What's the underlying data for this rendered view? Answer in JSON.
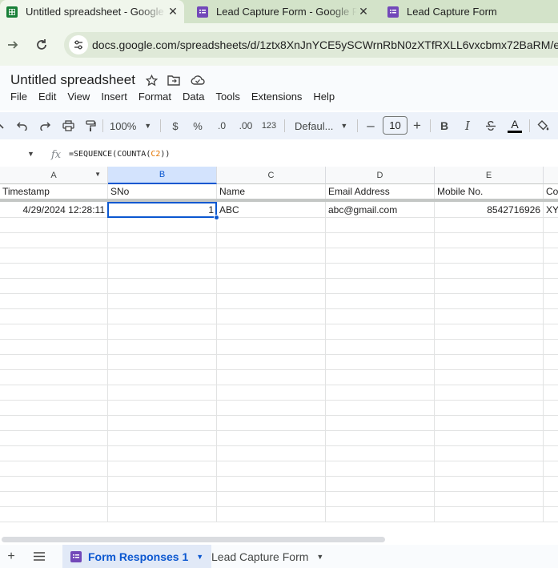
{
  "browser": {
    "tabs": [
      {
        "title": "Untitled spreadsheet - Google Sheets",
        "icon": "sheets-icon",
        "active": true
      },
      {
        "title": "Lead Capture Form - Google Forms",
        "icon": "forms-icon",
        "active": false
      },
      {
        "title": "Lead Capture Form",
        "icon": "forms-icon",
        "active": false
      }
    ],
    "url": "docs.google.com/spreadsheets/d/1ztx8XnJnYCE5ySCWrnRbN0zXTfRXLL6vxcbmx72BaRM/edit#"
  },
  "app": {
    "title": "Untitled spreadsheet",
    "menus": [
      "File",
      "Edit",
      "View",
      "Insert",
      "Format",
      "Data",
      "Tools",
      "Extensions",
      "Help"
    ]
  },
  "toolbar": {
    "zoom": "100%",
    "currency": "$",
    "percent": "%",
    "decimal_decrease": ".0",
    "decimal_increase": ".00",
    "number_format": "123",
    "font": "Defaul...",
    "font_size": "10",
    "bold": "B",
    "italic": "I",
    "text_color": "A"
  },
  "formula_bar": {
    "fx": "fx",
    "formula_prefix": "=SEQUENCE(COUNTA(",
    "formula_ref": "C2",
    "formula_suffix": "))"
  },
  "grid": {
    "columns": [
      "A",
      "B",
      "C",
      "D",
      "E"
    ],
    "selected_column": "B",
    "header_row": [
      "Timestamp",
      "SNo",
      "Name",
      "Email Address",
      "Mobile No.",
      "Co"
    ],
    "data_rows": [
      [
        "4/29/2024 12:28:11",
        "1",
        "ABC",
        "abc@gmail.com",
        "8542716926",
        "XY"
      ]
    ]
  },
  "sheets": {
    "tabs": [
      {
        "label": "Form Responses 1",
        "active": true
      },
      {
        "label": "Lead Capture Form",
        "active": false
      }
    ]
  },
  "colors": {
    "accent": "#0b57d0",
    "sheets_green": "#188038",
    "forms_purple": "#7248b9"
  }
}
